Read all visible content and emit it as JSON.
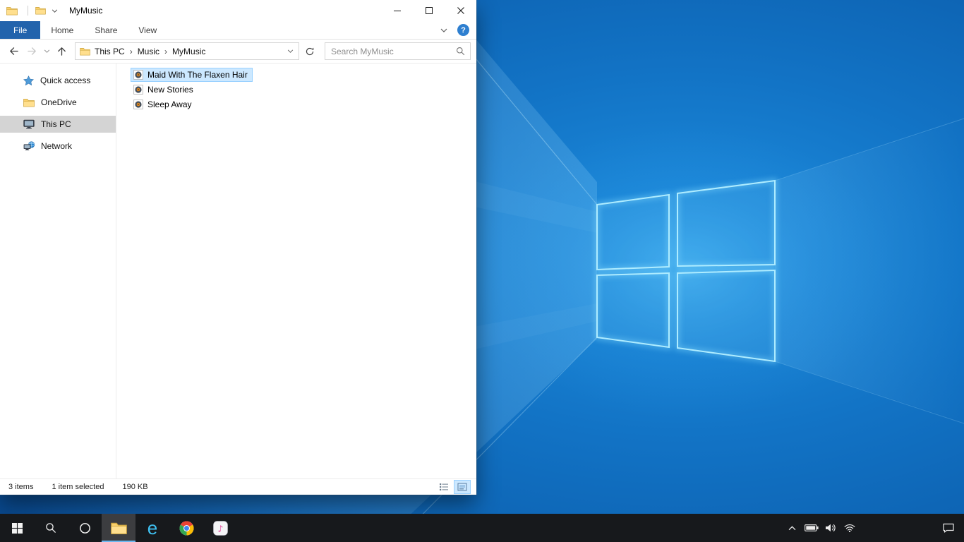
{
  "window": {
    "title": "MyMusic"
  },
  "ribbon": {
    "tabs": [
      {
        "label": "File",
        "active": true
      },
      {
        "label": "Home",
        "active": false
      },
      {
        "label": "Share",
        "active": false
      },
      {
        "label": "View",
        "active": false
      }
    ],
    "help_label": "?"
  },
  "navigation": {
    "breadcrumb": [
      {
        "label": "This PC"
      },
      {
        "label": "Music"
      },
      {
        "label": "MyMusic"
      }
    ],
    "breadcrumb_separator": "›",
    "search_placeholder": "Search MyMusic"
  },
  "sidebar": {
    "items": [
      {
        "label": "Quick access",
        "icon": "star-icon",
        "selected": false
      },
      {
        "label": "OneDrive",
        "icon": "folder-icon",
        "selected": false
      },
      {
        "label": "This PC",
        "icon": "computer-icon",
        "selected": true
      },
      {
        "label": "Network",
        "icon": "network-icon",
        "selected": false
      }
    ]
  },
  "files": [
    {
      "name": "Maid With The Flaxen Hair",
      "icon": "audio-file-icon",
      "selected": true
    },
    {
      "name": "New Stories",
      "icon": "audio-file-icon",
      "selected": false
    },
    {
      "name": "Sleep Away",
      "icon": "audio-file-icon",
      "selected": false
    }
  ],
  "statusbar": {
    "items_count": "3 items",
    "selection_summary": "1 item selected",
    "selection_size": "190 KB",
    "view_buttons": [
      "details-view",
      "large-icons-view"
    ]
  },
  "taskbar": {
    "buttons": [
      {
        "name": "start",
        "icon": "windows-logo-icon"
      },
      {
        "name": "search",
        "icon": "search-icon"
      },
      {
        "name": "cortana",
        "icon": "cortana-circle-icon"
      },
      {
        "name": "file-explorer",
        "icon": "folder-icon",
        "active": true
      },
      {
        "name": "internet-explorer",
        "icon": "ie-e-icon",
        "glyph": "e"
      },
      {
        "name": "chrome",
        "icon": "chrome-icon"
      },
      {
        "name": "itunes",
        "icon": "music-note-icon",
        "glyph": "♪"
      }
    ],
    "tray": [
      {
        "name": "hidden-icons",
        "icon": "chevron-up-icon"
      },
      {
        "name": "battery",
        "icon": "battery-icon"
      },
      {
        "name": "volume",
        "icon": "speaker-icon"
      },
      {
        "name": "network",
        "icon": "wifi-icon"
      },
      {
        "name": "action-center",
        "icon": "action-center-icon"
      }
    ]
  },
  "colors": {
    "accent_file_tab": "#2263ac",
    "selection_fill": "#cce8ff",
    "selection_border": "#99d1ff",
    "sidebar_selected": "#d4d4d4",
    "taskbar_bg": "#17191c",
    "wallpaper_blue": "#1273c5",
    "logo_stroke": "#aeecff"
  }
}
